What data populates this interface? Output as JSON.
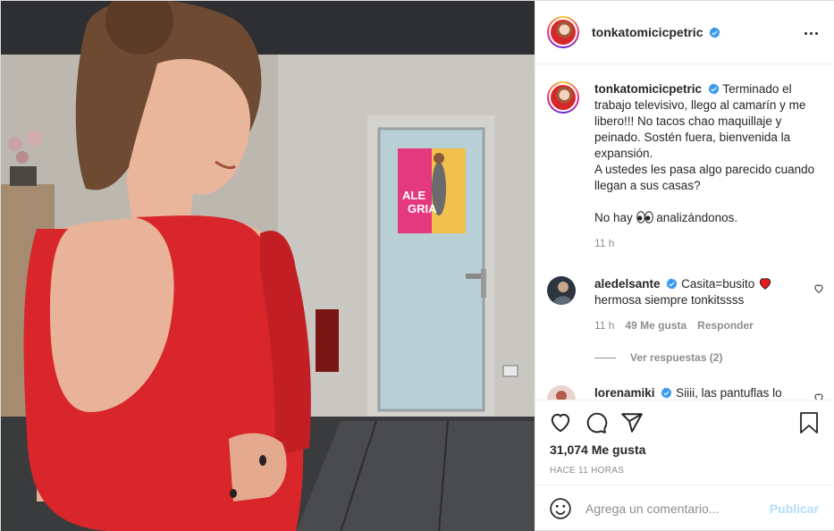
{
  "post": {
    "username": "tonkatomicicpetric",
    "more_label": "…",
    "photo": {
      "poster_text": "ALE\nGRIA"
    }
  },
  "caption": {
    "username": "tonkatomicicpetric",
    "text_before_emoji": "Terminado el trabajo televisivo, llego al camarín y me libero!!! No tacos chao maquillaje y peinado. Sostén fuera, bienvenida la expansión.\nA ustedes les pasa algo parecido cuando llegan a sus casas?\n\nNo hay ",
    "text_after_emoji": " analizándonos.",
    "time": "11 h"
  },
  "comments": [
    {
      "username": "aledelsante",
      "text_before_heart": "Casita=busito ",
      "text_after_heart": " hermosa siempre tonkitssss",
      "time": "11 h",
      "likes": "49 Me gusta",
      "reply_label": "Responder",
      "view_replies": "Ver respuestas (2)"
    },
    {
      "username": "lorenamiki",
      "text": "Siiii, las pantuflas lo"
    }
  ],
  "actions": {
    "likes": "31,074 Me gusta",
    "posted": "HACE 11 HORAS"
  },
  "composer": {
    "placeholder": "Agrega un comentario...",
    "publish_label": "Publicar"
  },
  "colors": {
    "verified": "#3897f0",
    "link_disabled": "#b2dffc",
    "dress": "#d9262b",
    "heart": "#ed4956"
  },
  "icons": [
    "verified-icon",
    "heart-icon",
    "comment-icon",
    "share-icon",
    "bookmark-icon",
    "emoji-icon",
    "more-icon",
    "small-heart-icon"
  ]
}
